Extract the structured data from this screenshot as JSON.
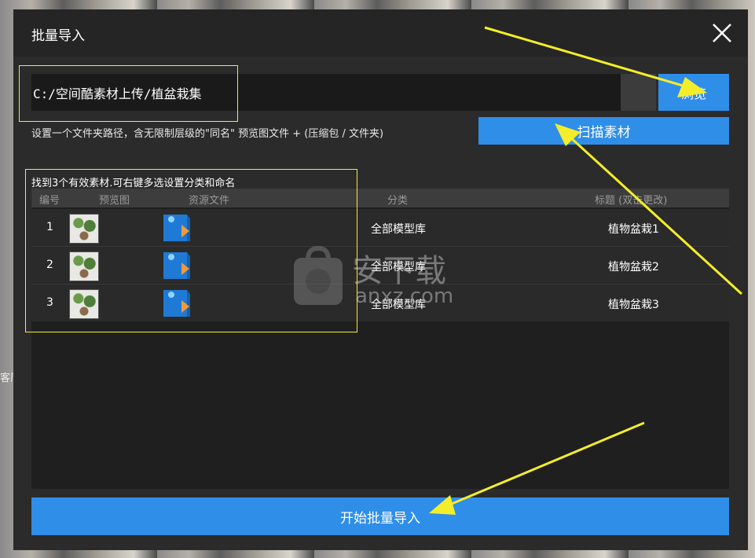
{
  "dialog": {
    "title": "批量导入",
    "path_value": "C:/空间酷素材上传/植盆栽集",
    "browse_label": "浏览",
    "hint": "设置一个文件夹路径，含无限制层级的\"同名\" 预览图文件 + (压缩包 / 文件夹)",
    "scan_label": "扫描素材",
    "found_label": "找到3个有效素材.可右键多选设置分类和命名",
    "start_label": "开始批量导入"
  },
  "table": {
    "headers": {
      "index": "编号",
      "preview": "预览图",
      "resource": "资源文件",
      "category": "分类",
      "title": "标题 (双击更改)"
    },
    "rows": [
      {
        "index": "1",
        "category": "全部模型库",
        "title": "植物盆栽1"
      },
      {
        "index": "2",
        "category": "全部模型库",
        "title": "植物盆栽2"
      },
      {
        "index": "3",
        "category": "全部模型库",
        "title": "植物盆栽3"
      }
    ]
  },
  "background": {
    "side_text": "客厅"
  },
  "watermark": {
    "text": "安下载",
    "sub": "anxz.com"
  },
  "colors": {
    "accent": "#2f8ee8",
    "annotation": "#f4ee2a",
    "dialog_bg": "#2b2b2b"
  },
  "icons": {
    "close": "close-icon",
    "file": "file-icon",
    "thumbnail": "plant-thumbnail"
  }
}
